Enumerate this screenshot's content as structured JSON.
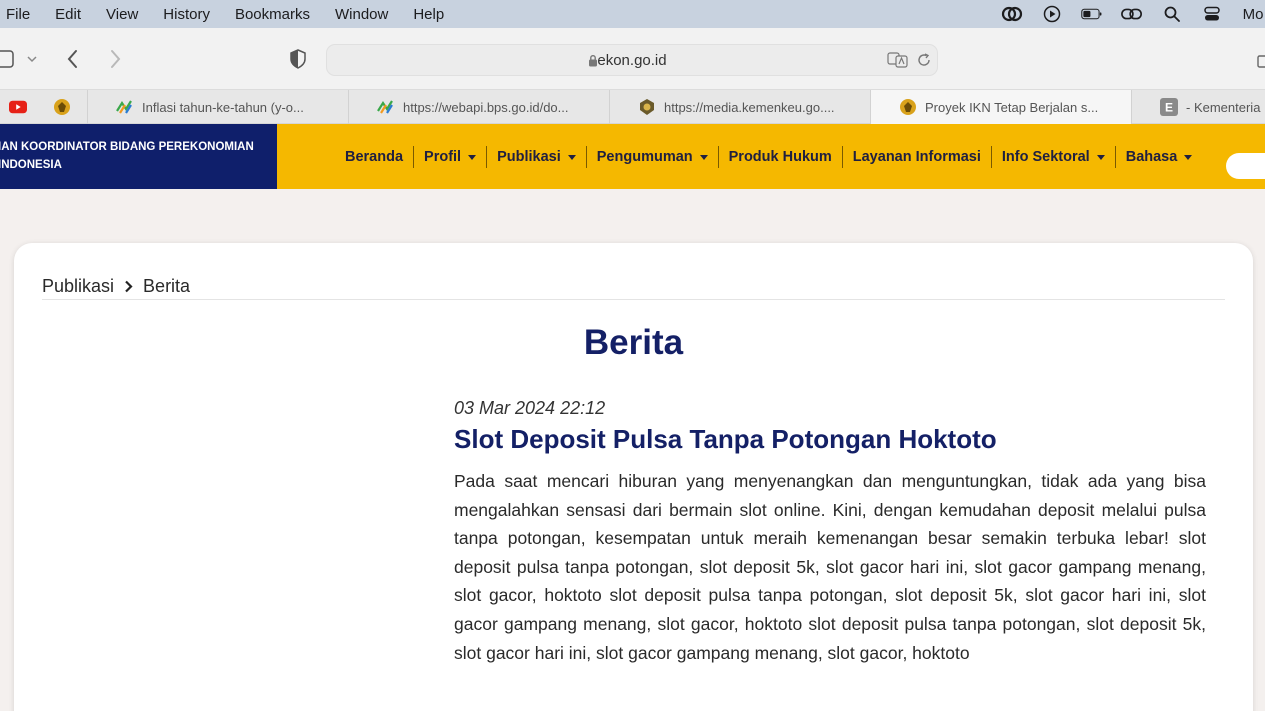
{
  "menubar": {
    "items": [
      "File",
      "Edit",
      "View",
      "History",
      "Bookmarks",
      "Window",
      "Help"
    ],
    "clock": "Mo"
  },
  "toolbar": {
    "url": "ekon.go.id"
  },
  "tabs": [
    {
      "label": "",
      "icon": "youtube-icon"
    },
    {
      "label": "",
      "icon": "garuda-icon"
    },
    {
      "label": "Inflasi tahun-ke-tahun (y-o...",
      "icon": "bps-icon"
    },
    {
      "label": "https://webapi.bps.go.id/do...",
      "icon": "bps-icon"
    },
    {
      "label": "https://media.kemenkeu.go....",
      "icon": "kemenkeu-icon"
    },
    {
      "label": "Proyek IKN Tetap Berjalan s...",
      "icon": "garuda-icon"
    },
    {
      "label": "- Kementeria",
      "icon": "e-icon"
    }
  ],
  "site": {
    "logo_line1": "IAN KOORDINATOR BIDANG PEREKONOMIAN",
    "logo_line2": "INDONESIA",
    "nav": [
      {
        "label": "Beranda",
        "dropdown": false
      },
      {
        "label": "Profil",
        "dropdown": true
      },
      {
        "label": "Publikasi",
        "dropdown": true
      },
      {
        "label": "Pengumuman",
        "dropdown": true
      },
      {
        "label": "Produk Hukum",
        "dropdown": false
      },
      {
        "label": "Layanan Informasi",
        "dropdown": false
      },
      {
        "label": "Info Sektoral",
        "dropdown": true
      },
      {
        "label": "Bahasa",
        "dropdown": true
      }
    ],
    "colors": {
      "header": "#f5b800",
      "logo_bg": "#0f1f6b",
      "title": "#142066"
    }
  },
  "breadcrumb": {
    "parent": "Publikasi",
    "current": "Berita"
  },
  "page": {
    "title": "Berita"
  },
  "article": {
    "date": "03 Mar 2024 22:12",
    "title": "Slot Deposit Pulsa Tanpa Potongan Hoktoto",
    "body": "Pada saat mencari hiburan yang menyenangkan dan menguntungkan, tidak ada yang bisa mengalahkan sensasi dari bermain slot online. Kini, dengan kemudahan deposit melalui pulsa tanpa potongan, kesempatan untuk meraih kemenangan besar semakin terbuka lebar! slot deposit pulsa tanpa potongan, slot deposit 5k, slot gacor hari ini, slot gacor gampang menang, slot gacor, hoktoto slot deposit pulsa tanpa potongan, slot deposit 5k, slot gacor hari ini, slot gacor gampang menang, slot gacor, hoktoto slot deposit pulsa tanpa potongan, slot deposit 5k, slot gacor hari ini, slot gacor gampang menang, slot gacor, hoktoto"
  }
}
